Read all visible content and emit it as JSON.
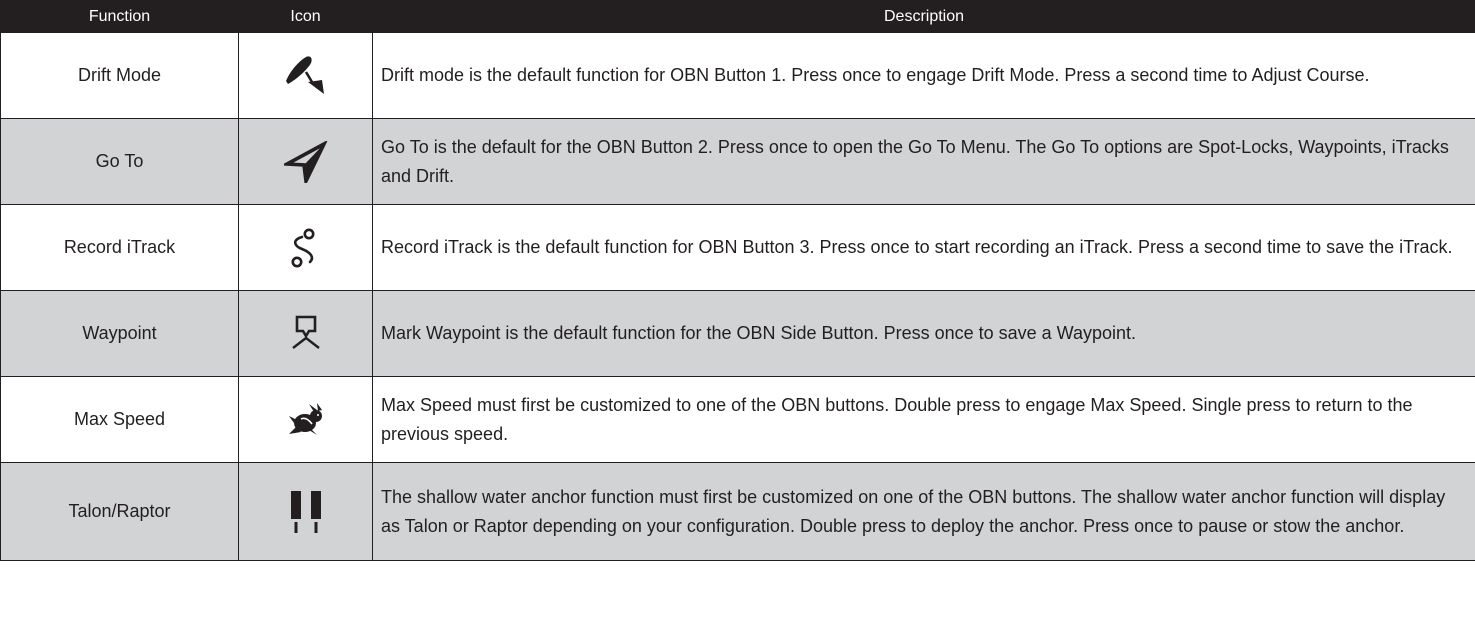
{
  "table": {
    "headers": {
      "function": "Function",
      "icon": "Icon",
      "description": "Description"
    },
    "rows": [
      {
        "function": "Drift Mode",
        "icon": "drift-mode-icon",
        "description": "Drift mode is the default function for OBN Button 1. Press once to engage Drift Mode. Press a second time to Adjust Course."
      },
      {
        "function": "Go To",
        "icon": "go-to-arrow-icon",
        "description": "Go To is the default for the OBN Button 2. Press once to open the Go To Menu. The Go To options are Spot-Locks, Waypoints, iTracks and Drift."
      },
      {
        "function": "Record iTrack",
        "icon": "record-itrack-icon",
        "description": "Record iTrack is the default function for OBN Button 3. Press once to start recording an iTrack. Press a second time to save the iTrack."
      },
      {
        "function": "Waypoint",
        "icon": "waypoint-icon",
        "description": "Mark Waypoint is the default function for the OBN Side Button. Press once to save a Waypoint."
      },
      {
        "function": "Max Speed",
        "icon": "rabbit-icon",
        "description": "Max Speed must first be customized to one of the OBN buttons. Double press to engage Max Speed. Single press to return to the previous speed."
      },
      {
        "function": "Talon/Raptor",
        "icon": "shallow-water-anchor-icon",
        "description": "The shallow water anchor function must first be customized on one of the OBN buttons. The shallow water anchor function will display as Talon or Raptor depending on your configuration. Double press to deploy the anchor. Press once to pause or stow the anchor."
      }
    ]
  },
  "colors": {
    "header_bg": "#231f20",
    "row_alt_bg": "#d1d3d4",
    "text": "#231f20"
  }
}
